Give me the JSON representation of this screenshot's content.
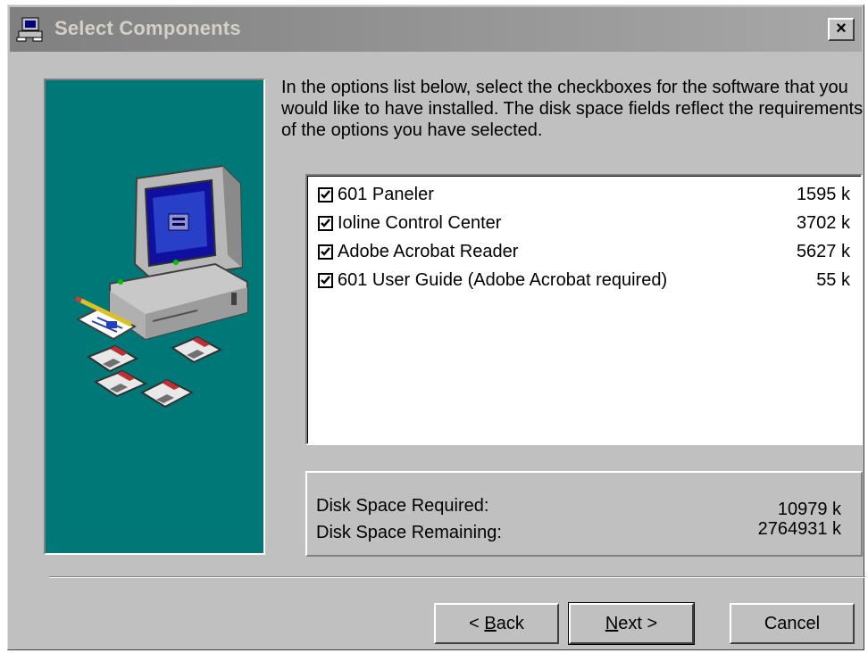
{
  "window": {
    "title": "Select Components",
    "close_label": "×"
  },
  "instructions": "In the options list below, select the checkboxes for the software that you would like to have installed.  The disk space fields reflect the requirements of the options you have selected.",
  "components": [
    {
      "label": "601 Paneler",
      "size": "1595 k",
      "checked": true
    },
    {
      "label": "Ioline Control Center",
      "size": "3702 k",
      "checked": true
    },
    {
      "label": "Adobe Acrobat Reader",
      "size": "5627 k",
      "checked": true
    },
    {
      "label": "601 User Guide (Adobe Acrobat required)",
      "size": "55 k",
      "checked": true
    }
  ],
  "disk": {
    "required_label": "Disk Space Required:",
    "required_value": "10979 k",
    "remaining_label": "Disk Space Remaining:",
    "remaining_value": "2764931 k"
  },
  "buttons": {
    "back_pre": "< ",
    "back_key": "B",
    "back_rest": "ack",
    "next_key": "N",
    "next_rest": "ext >",
    "cancel": "Cancel"
  },
  "icons": {
    "title": "setup-computer-icon",
    "art": "computer-with-disks-illustration"
  },
  "colors": {
    "art_background": "#007878",
    "dialog_face": "#c0c0c0"
  }
}
